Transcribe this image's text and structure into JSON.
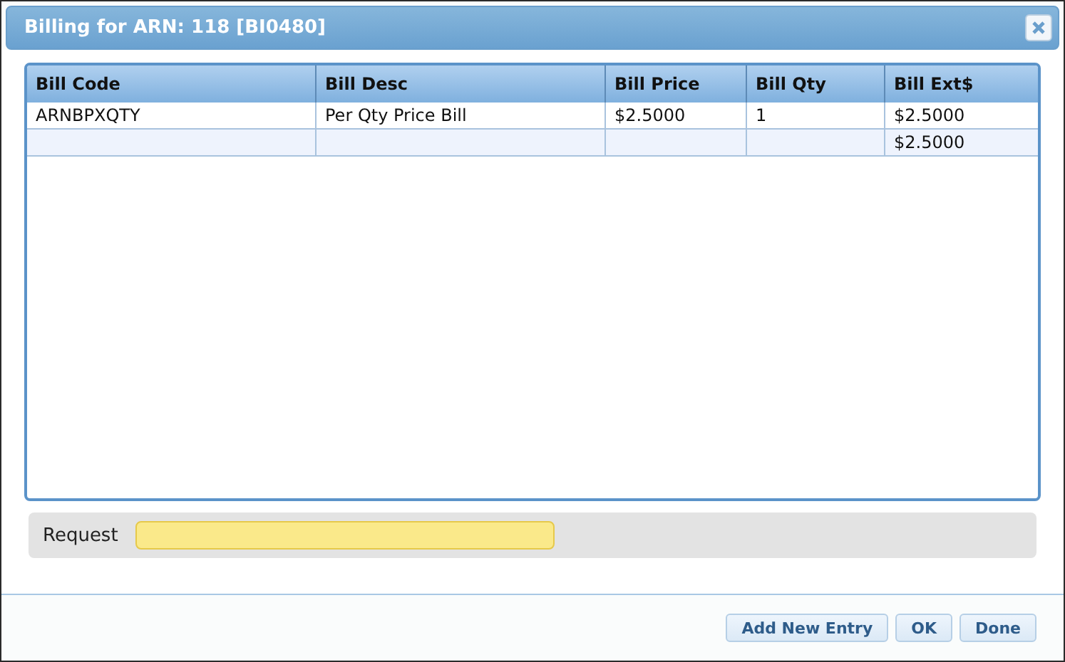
{
  "window": {
    "title": "Billing for ARN: 118 [BI0480]"
  },
  "table": {
    "columns": [
      "Bill Code",
      "Bill Desc",
      "Bill Price",
      "Bill Qty",
      "Bill Ext$"
    ],
    "rows": [
      {
        "code": "ARNBPXQTY",
        "desc": "Per Qty Price Bill",
        "price": "$2.5000",
        "qty": "1",
        "ext": "$2.5000"
      }
    ],
    "total_row": {
      "ext": "$2.5000"
    }
  },
  "request": {
    "label": "Request"
  },
  "buttons": [
    "Add New Entry",
    "OK",
    "Done"
  ]
}
